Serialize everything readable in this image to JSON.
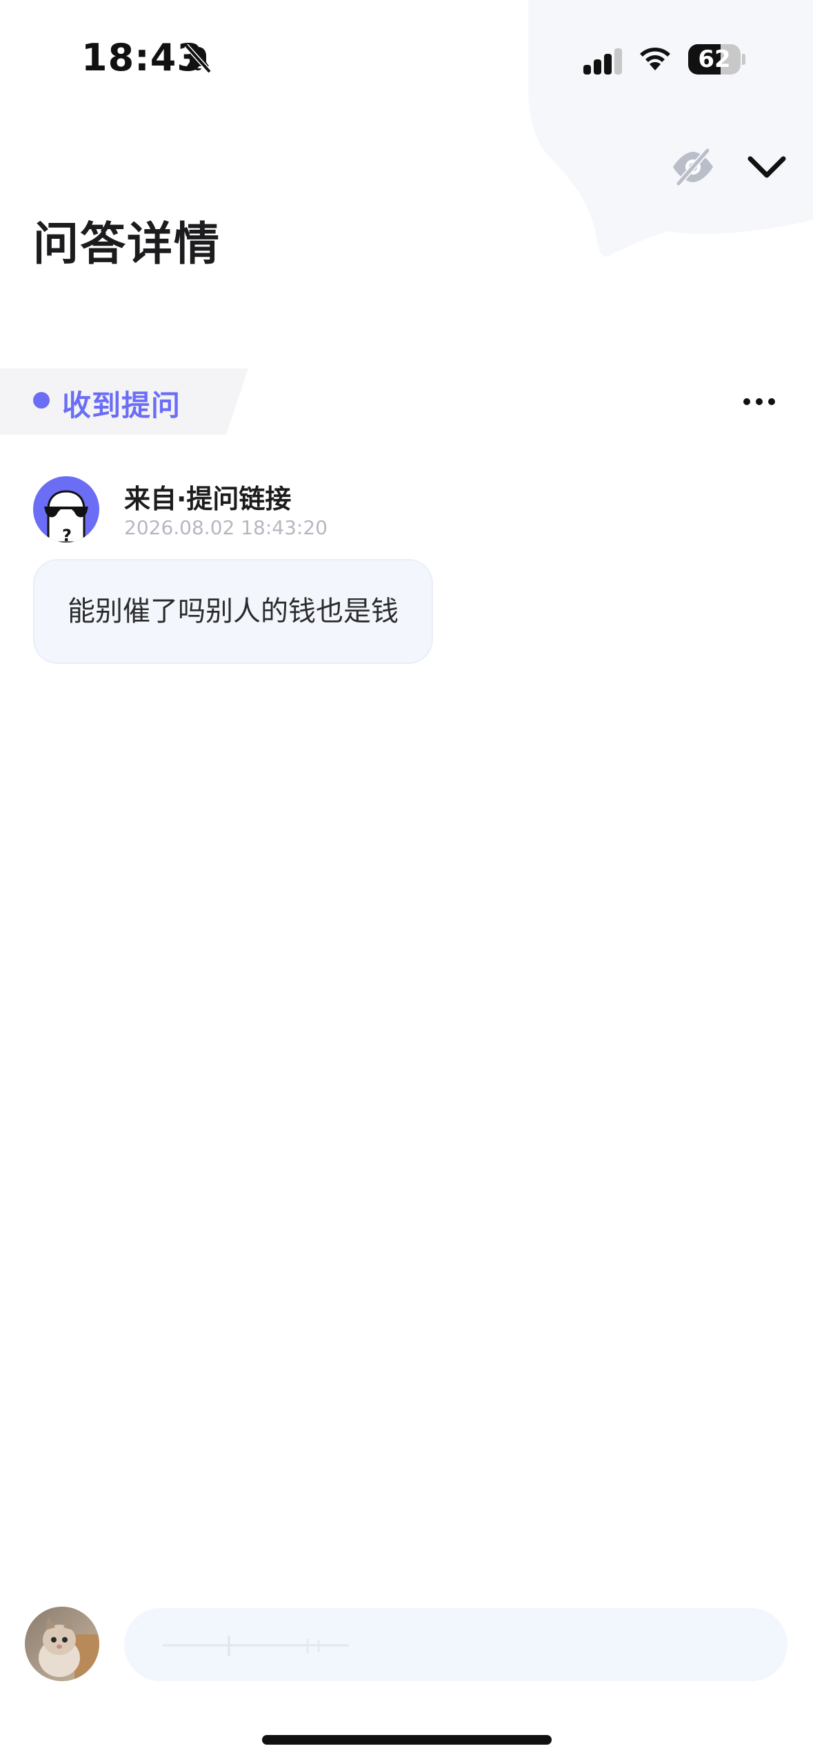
{
  "status_bar": {
    "time": "18:43",
    "battery_level": "62",
    "battery_fraction": 0.62
  },
  "header": {
    "title": "问答详情",
    "actions": [
      "eye-off-icon",
      "chevron-down-icon"
    ]
  },
  "question": {
    "tag_label": "收到提问",
    "sender_name": "来自·提问链接",
    "timestamp": "2026.08.02 18:43:20",
    "message": "能别催了吗别人的钱也是钱"
  },
  "colors": {
    "accent": "#6b6ef5",
    "bubble_bg": "#f3f7fd",
    "tag_bg": "#f4f4f6"
  }
}
